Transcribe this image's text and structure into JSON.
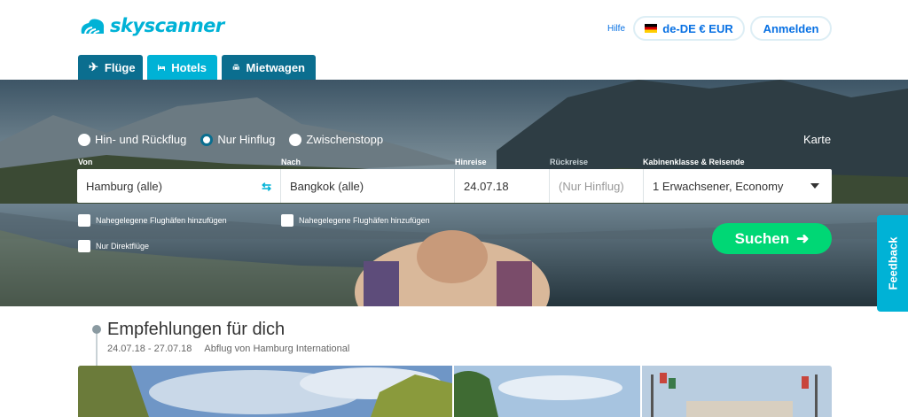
{
  "header": {
    "logo_text": "skyscanner",
    "help_label": "Hilfe",
    "locale_label": "de-DE € EUR",
    "login_label": "Anmelden"
  },
  "tabs": [
    {
      "label": "Flüge",
      "icon": "airplane-icon",
      "active": true
    },
    {
      "label": "Hotels",
      "icon": "bed-icon",
      "active": false
    },
    {
      "label": "Mietwagen",
      "icon": "car-icon",
      "active": false
    }
  ],
  "search": {
    "trip_types": [
      {
        "label": "Hin- und Rückflug",
        "checked": false
      },
      {
        "label": "Nur Hinflug",
        "checked": true
      },
      {
        "label": "Zwischenstopp",
        "checked": false
      }
    ],
    "map_label": "Karte",
    "from_label": "Von",
    "to_label": "Nach",
    "depart_label": "Hinreise",
    "return_label": "Rückreise",
    "cabin_label": "Kabinenklasse & Reisende",
    "from_value": "Hamburg (alle)",
    "to_value": "Bangkok (alle)",
    "depart_value": "24.07.18",
    "return_value": "(Nur Hinflug)",
    "cabin_value": "1 Erwachsener, Economy",
    "nearby_from_label": "Nahegelegene Flughäfen hinzufügen",
    "nearby_to_label": "Nahegelegene Flughäfen hinzufügen",
    "direct_only_label": "Nur Direktflüge",
    "search_button_label": "Suchen"
  },
  "feedback_label": "Feedback",
  "recommendations": {
    "title": "Empfehlungen für dich",
    "dates": "24.07.18 - 27.07.18",
    "departure": "Abflug von Hamburg International"
  },
  "colors": {
    "brand": "#00b2d6",
    "tab_dark": "#0b6e8f",
    "search_green": "#00d775",
    "link_blue": "#0770e3"
  }
}
